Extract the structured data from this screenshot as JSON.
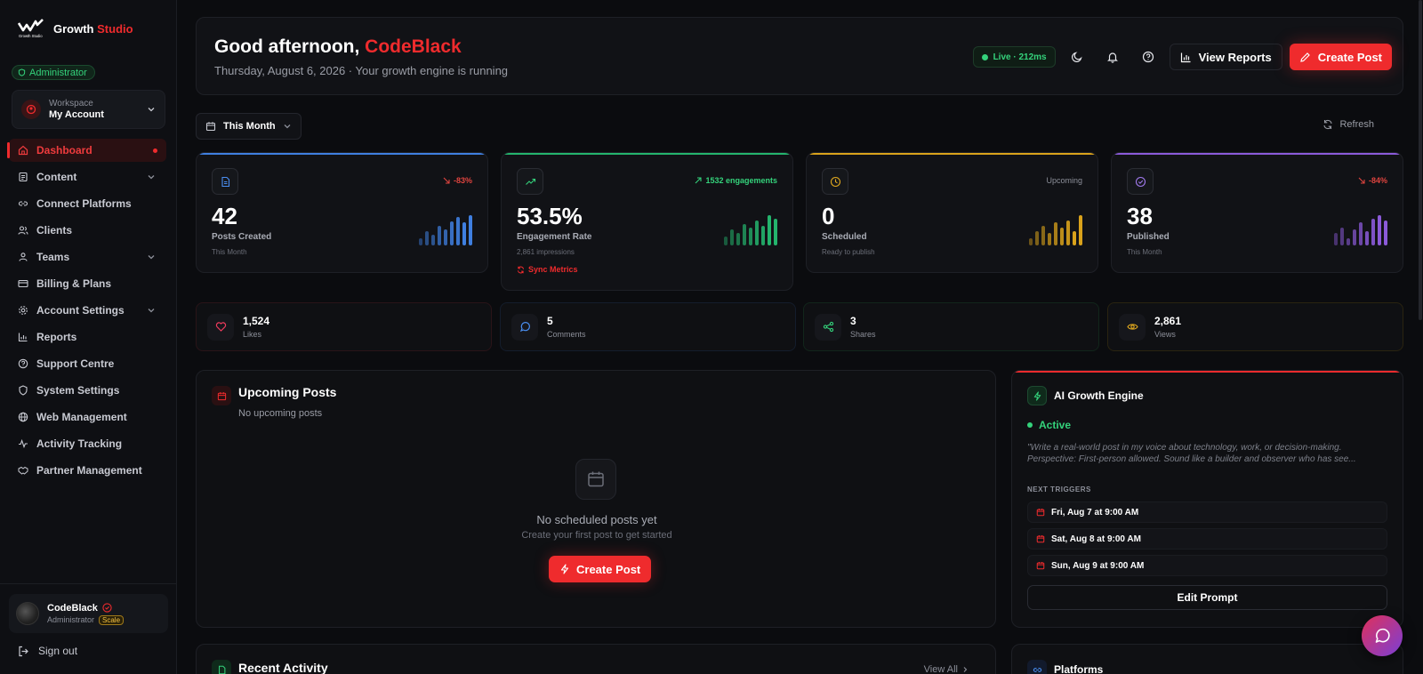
{
  "brand": {
    "name": "Growth",
    "accent": "Studio",
    "tagline": "Growth Studio"
  },
  "sidebar": {
    "role_pill": "Administrator",
    "workspace": {
      "label": "Workspace",
      "name": "My Account"
    },
    "items": [
      {
        "label": "Dashboard",
        "icon": "home-icon",
        "active": true
      },
      {
        "label": "Content",
        "icon": "file-icon",
        "expandable": true
      },
      {
        "label": "Connect Platforms",
        "icon": "link-icon"
      },
      {
        "label": "Clients",
        "icon": "users-icon"
      },
      {
        "label": "Teams",
        "icon": "team-icon",
        "expandable": true
      },
      {
        "label": "Billing & Plans",
        "icon": "credit-card-icon"
      },
      {
        "label": "Account Settings",
        "icon": "gear-icon",
        "expandable": true
      },
      {
        "label": "Reports",
        "icon": "bar-chart-icon"
      },
      {
        "label": "Support Centre",
        "icon": "help-circle-icon"
      },
      {
        "label": "System Settings",
        "icon": "shield-icon"
      },
      {
        "label": "Web Management",
        "icon": "globe-icon"
      },
      {
        "label": "Activity Tracking",
        "icon": "activity-icon"
      },
      {
        "label": "Partner Management",
        "icon": "handshake-icon"
      }
    ],
    "profile": {
      "name": "CodeBlack",
      "role": "Administrator",
      "plan": "Scale"
    },
    "signout": "Sign out"
  },
  "header": {
    "greeting": "Good afternoon,",
    "user": "CodeBlack",
    "subtitle": "Thursday, August 6, 2026 · Your growth engine is running",
    "live": "Live · 212ms",
    "view_reports": "View Reports",
    "create_post": "Create Post"
  },
  "filter": {
    "period": "This Month",
    "refresh": "Refresh"
  },
  "stats": [
    {
      "value": "42",
      "label": "Posts Created",
      "sub": "This Month",
      "trend": "-83%",
      "trend_color": "#e0443f",
      "accent": "#3f7fe0",
      "icon": "document-icon"
    },
    {
      "value": "53.5%",
      "label": "Engagement Rate",
      "sub": "2,861 impressions",
      "trend": "1532 engagements",
      "trend_color": "#34d27b",
      "accent": "#24b46d",
      "icon": "trending-up-icon",
      "action": "Sync Metrics"
    },
    {
      "value": "0",
      "label": "Scheduled",
      "sub": "Ready to publish",
      "trend": "Upcoming",
      "trend_color": "#8c8f99",
      "accent": "#d9a21b",
      "icon": "clock-icon"
    },
    {
      "value": "38",
      "label": "Published",
      "sub": "This Month",
      "trend": "-84%",
      "trend_color": "#e0443f",
      "accent": "#8b5ad9",
      "icon": "check-circle-icon"
    }
  ],
  "engagement": [
    {
      "value": "1,524",
      "label": "Likes",
      "icon": "heart-icon",
      "color": "#ef3b5d",
      "border": "#2a1418"
    },
    {
      "value": "5",
      "label": "Comments",
      "icon": "message-icon",
      "color": "#4a8ef0",
      "border": "#141d2c"
    },
    {
      "value": "3",
      "label": "Shares",
      "icon": "share-icon",
      "color": "#34d27b",
      "border": "#12261b"
    },
    {
      "value": "2,861",
      "label": "Views",
      "icon": "eye-icon",
      "color": "#e0a81e",
      "border": "#2a2410"
    }
  ],
  "upcoming": {
    "title": "Upcoming Posts",
    "subtitle": "No upcoming posts",
    "empty_title": "No scheduled posts yet",
    "empty_sub": "Create your first post to get started",
    "button": "Create Post"
  },
  "ai": {
    "title": "AI Growth Engine",
    "status": "Active",
    "prompt": "\"Write a real-world post in my voice about technology, work, or decision-making. Perspective: First-person allowed. Sound like a builder and observer who has see...",
    "next_label": "NEXT TRIGGERS",
    "triggers": [
      "Fri, Aug 7 at 9:00 AM",
      "Sat, Aug 8 at 9:00 AM",
      "Sun, Aug 9 at 9:00 AM"
    ],
    "edit_button": "Edit Prompt"
  },
  "recent": {
    "title": "Recent Activity",
    "link": "View All"
  },
  "platforms": {
    "title": "Platforms"
  }
}
